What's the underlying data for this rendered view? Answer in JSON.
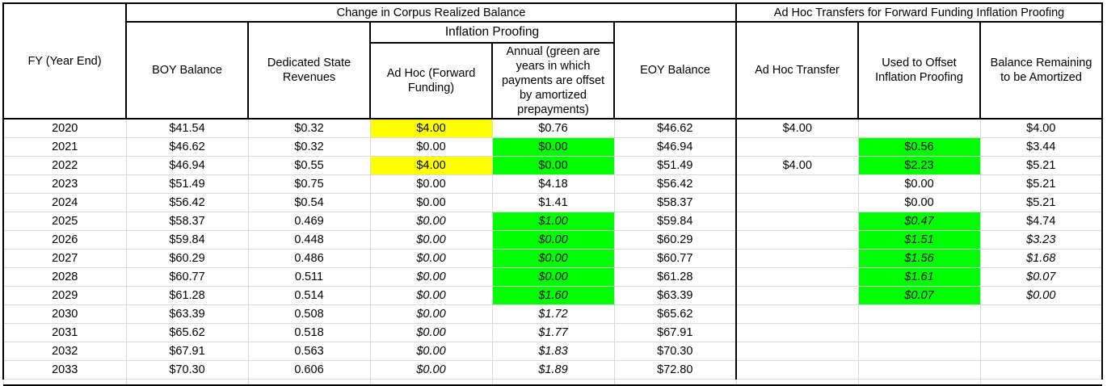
{
  "header": {
    "fy": "FY (Year End)",
    "group_corpus": "Change in Corpus Realized Balance",
    "group_adhoc": "Ad Hoc Transfers for Forward Funding Inflation Proofing",
    "inflation_proofing": "Inflation Proofing",
    "boy": "BOY Balance",
    "dedicated": "Dedicated State Revenues",
    "adhoc_forward": "Ad Hoc (Forward Funding)",
    "annual": "Annual (green are years in which payments are offset by amortized prepayments)",
    "eoy": "EOY Balance",
    "adhoc_transfer": "Ad Hoc Transfer",
    "used_offset": "Used to Offset Inflation Proofing",
    "balance_remaining": "Balance Remaining to be Amortized"
  },
  "colors": {
    "yellow": "#ffff00",
    "green": "#00ff00"
  },
  "rows": [
    {
      "fy": "2020",
      "boy": "$41.54",
      "ded": "$0.32",
      "adhoc": "$4.00",
      "annual": "$0.76",
      "eoy": "$46.62",
      "transfer": "$4.00",
      "used": "",
      "remain": "$4.00",
      "adhoc_hl": "yellow",
      "annual_hl": "",
      "used_hl": "",
      "italic_adhoc": false,
      "italic_annual": false,
      "italic_used": false,
      "italic_remain": false
    },
    {
      "fy": "2021",
      "boy": "$46.62",
      "ded": "$0.32",
      "adhoc": "$0.00",
      "annual": "$0.00",
      "eoy": "$46.94",
      "transfer": "",
      "used": "$0.56",
      "remain": "$3.44",
      "adhoc_hl": "",
      "annual_hl": "green",
      "used_hl": "green",
      "italic_adhoc": false,
      "italic_annual": false,
      "italic_used": false,
      "italic_remain": false
    },
    {
      "fy": "2022",
      "boy": "$46.94",
      "ded": "$0.55",
      "adhoc": "$4.00",
      "annual": "$0.00",
      "eoy": "$51.49",
      "transfer": "$4.00",
      "used": "$2.23",
      "remain": "$5.21",
      "adhoc_hl": "yellow",
      "annual_hl": "green",
      "used_hl": "green",
      "italic_adhoc": false,
      "italic_annual": false,
      "italic_used": false,
      "italic_remain": false
    },
    {
      "fy": "2023",
      "boy": "$51.49",
      "ded": "$0.75",
      "adhoc": "$0.00",
      "annual": "$4.18",
      "eoy": "$56.42",
      "transfer": "",
      "used": "$0.00",
      "remain": "$5.21",
      "adhoc_hl": "",
      "annual_hl": "",
      "used_hl": "",
      "italic_adhoc": false,
      "italic_annual": false,
      "italic_used": false,
      "italic_remain": false
    },
    {
      "fy": "2024",
      "boy": "$56.42",
      "ded": "$0.54",
      "adhoc": "$0.00",
      "annual": "$1.41",
      "eoy": "$58.37",
      "transfer": "",
      "used": "$0.00",
      "remain": "$5.21",
      "adhoc_hl": "",
      "annual_hl": "",
      "used_hl": "",
      "italic_adhoc": false,
      "italic_annual": false,
      "italic_used": false,
      "italic_remain": false
    },
    {
      "fy": "2025",
      "boy": "$58.37",
      "ded": "0.469",
      "adhoc": "$0.00",
      "annual": "$1.00",
      "eoy": "$59.84",
      "transfer": "",
      "used": "$0.47",
      "remain": "$4.74",
      "adhoc_hl": "",
      "annual_hl": "green",
      "used_hl": "green",
      "italic_adhoc": true,
      "italic_annual": true,
      "italic_used": true,
      "italic_remain": false
    },
    {
      "fy": "2026",
      "boy": "$59.84",
      "ded": "0.448",
      "adhoc": "$0.00",
      "annual": "$0.00",
      "eoy": "$60.29",
      "transfer": "",
      "used": "$1.51",
      "remain": "$3.23",
      "adhoc_hl": "",
      "annual_hl": "green",
      "used_hl": "green",
      "italic_adhoc": true,
      "italic_annual": true,
      "italic_used": true,
      "italic_remain": true
    },
    {
      "fy": "2027",
      "boy": "$60.29",
      "ded": "0.486",
      "adhoc": "$0.00",
      "annual": "$0.00",
      "eoy": "$60.77",
      "transfer": "",
      "used": "$1.56",
      "remain": "$1.68",
      "adhoc_hl": "",
      "annual_hl": "green",
      "used_hl": "green",
      "italic_adhoc": true,
      "italic_annual": true,
      "italic_used": true,
      "italic_remain": true
    },
    {
      "fy": "2028",
      "boy": "$60.77",
      "ded": "0.511",
      "adhoc": "$0.00",
      "annual": "$0.00",
      "eoy": "$61.28",
      "transfer": "",
      "used": "$1.61",
      "remain": "$0.07",
      "adhoc_hl": "",
      "annual_hl": "green",
      "used_hl": "green",
      "italic_adhoc": true,
      "italic_annual": true,
      "italic_used": true,
      "italic_remain": true
    },
    {
      "fy": "2029",
      "boy": "$61.28",
      "ded": "0.514",
      "adhoc": "$0.00",
      "annual": "$1.60",
      "eoy": "$63.39",
      "transfer": "",
      "used": "$0.07",
      "remain": "$0.00",
      "adhoc_hl": "",
      "annual_hl": "green",
      "used_hl": "green",
      "italic_adhoc": true,
      "italic_annual": true,
      "italic_used": true,
      "italic_remain": true
    },
    {
      "fy": "2030",
      "boy": "$63.39",
      "ded": "0.508",
      "adhoc": "$0.00",
      "annual": "$1.72",
      "eoy": "$65.62",
      "transfer": "",
      "used": "",
      "remain": "",
      "adhoc_hl": "",
      "annual_hl": "",
      "used_hl": "",
      "italic_adhoc": true,
      "italic_annual": true,
      "italic_used": false,
      "italic_remain": false
    },
    {
      "fy": "2031",
      "boy": "$65.62",
      "ded": "0.518",
      "adhoc": "$0.00",
      "annual": "$1.77",
      "eoy": "$67.91",
      "transfer": "",
      "used": "",
      "remain": "",
      "adhoc_hl": "",
      "annual_hl": "",
      "used_hl": "",
      "italic_adhoc": true,
      "italic_annual": true,
      "italic_used": false,
      "italic_remain": false
    },
    {
      "fy": "2032",
      "boy": "$67.91",
      "ded": "0.563",
      "adhoc": "$0.00",
      "annual": "$1.83",
      "eoy": "$70.30",
      "transfer": "",
      "used": "",
      "remain": "",
      "adhoc_hl": "",
      "annual_hl": "",
      "used_hl": "",
      "italic_adhoc": true,
      "italic_annual": true,
      "italic_used": false,
      "italic_remain": false
    },
    {
      "fy": "2033",
      "boy": "$70.30",
      "ded": "0.606",
      "adhoc": "$0.00",
      "annual": "$1.89",
      "eoy": "$72.80",
      "transfer": "",
      "used": "",
      "remain": "",
      "adhoc_hl": "",
      "annual_hl": "",
      "used_hl": "",
      "italic_adhoc": true,
      "italic_annual": true,
      "italic_used": false,
      "italic_remain": false
    }
  ]
}
